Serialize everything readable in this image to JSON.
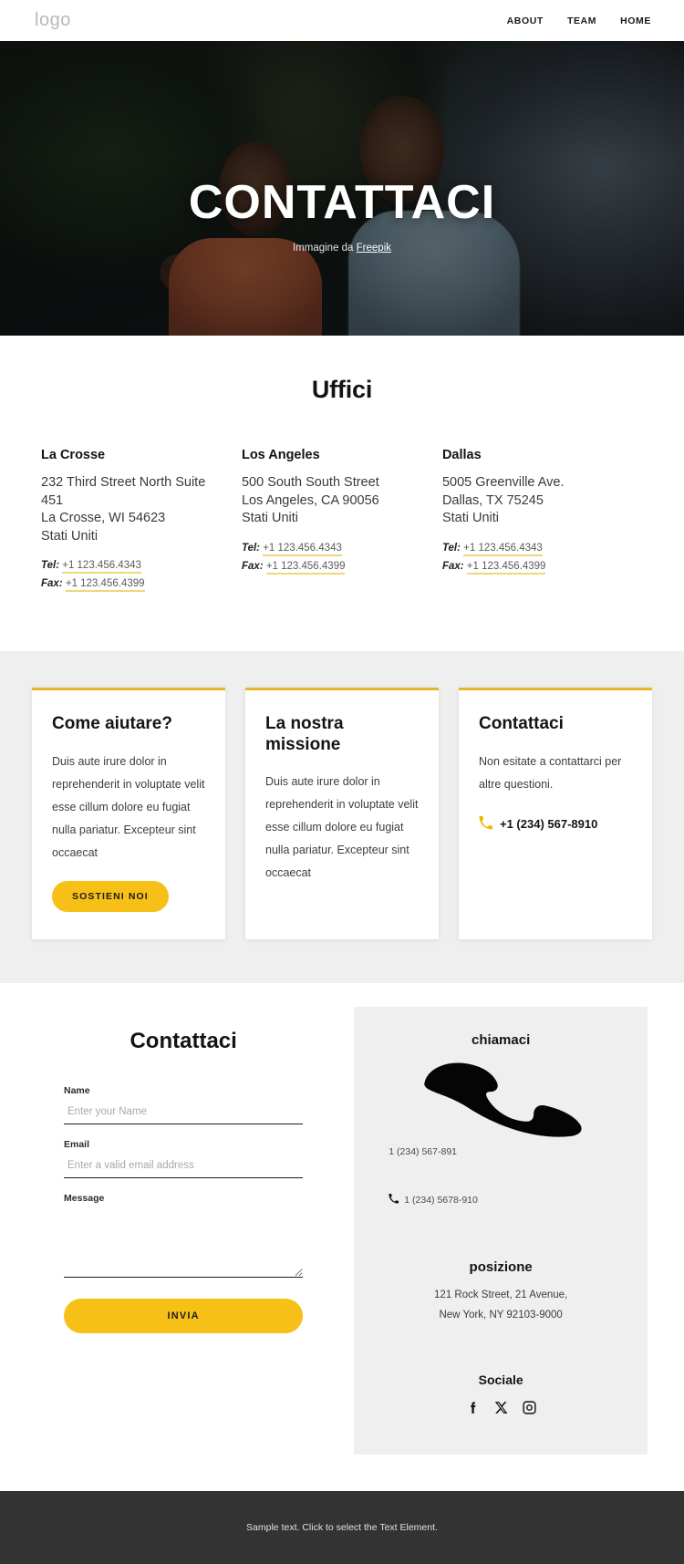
{
  "header": {
    "logo": "logo",
    "nav": [
      {
        "label": "ABOUT"
      },
      {
        "label": "TEAM"
      },
      {
        "label": "HOME"
      }
    ]
  },
  "hero": {
    "title": "CONTATTACI",
    "credit_prefix": "Immagine da ",
    "credit_link": "Freepik"
  },
  "offices": {
    "title": "Uffici",
    "items": [
      {
        "name": "La Crosse",
        "address": "232 Third Street North Suite 451\nLa Crosse, WI 54623\nStati Uniti",
        "tel_label": "Tel:",
        "tel": "+1 123.456.4343",
        "fax_label": "Fax:",
        "fax": "+1 123.456.4399"
      },
      {
        "name": "Los Angeles",
        "address": "500 South South Street\nLos Angeles, CA 90056\nStati Uniti",
        "tel_label": "Tel:",
        "tel": "+1 123.456.4343",
        "fax_label": "Fax:",
        "fax": "+1 123.456.4399"
      },
      {
        "name": "Dallas",
        "address": "5005 Greenville Ave.\nDallas, TX 75245\nStati Uniti",
        "tel_label": "Tel:",
        "tel": "+1 123.456.4343",
        "fax_label": "Fax:",
        "fax": "+1 123.456.4399"
      }
    ]
  },
  "cards": [
    {
      "title": "Come aiutare?",
      "body": "Duis aute irure dolor in reprehenderit in voluptate velit esse cillum dolore eu fugiat nulla pariatur. Excepteur sint occaecat",
      "button": "SOSTIENI NOI"
    },
    {
      "title": "La nostra missione",
      "body": "Duis aute irure dolor in reprehenderit in voluptate velit esse cillum dolore eu fugiat nulla pariatur. Excepteur sint occaecat"
    },
    {
      "title": "Contattaci",
      "body": "Non esitate a contattarci per altre questioni.",
      "phone": "+1 (234) 567-8910"
    }
  ],
  "contact": {
    "form_title": "Contattaci",
    "fields": {
      "name_label": "Name",
      "name_placeholder": "Enter your Name",
      "name_value": "",
      "email_label": "Email",
      "email_placeholder": "Enter a valid email address",
      "email_value": "",
      "message_label": "Message",
      "message_placeholder": "",
      "message_value": ""
    },
    "submit_label": "INVIA"
  },
  "info": {
    "call_title": "chiamaci",
    "phone_primary": "1 (234) 567-891",
    "phone_secondary": "1 (234) 5678-910",
    "location_title": "posizione",
    "address": "121 Rock Street, 21 Avenue,\nNew York, NY 92103-9000",
    "social_title": "Sociale",
    "social": [
      {
        "name": "facebook-icon"
      },
      {
        "name": "x-twitter-icon"
      },
      {
        "name": "instagram-icon"
      }
    ]
  },
  "footer": {
    "text": "Sample text. Click to select the Text Element."
  },
  "colors": {
    "accent_yellow": "#f7c017",
    "card_border": "#e8b62c",
    "link_underline": "#f0d77a",
    "band_grey": "#efefef",
    "footer_dark": "#333333"
  }
}
